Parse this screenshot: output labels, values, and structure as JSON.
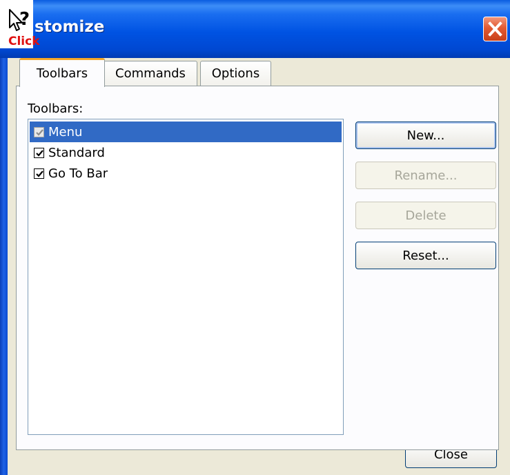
{
  "window": {
    "title": "stomize",
    "help_cursor_label": "Click"
  },
  "tabs": [
    {
      "label": "Toolbars",
      "active": true
    },
    {
      "label": "Commands",
      "active": false
    },
    {
      "label": "Options",
      "active": false
    }
  ],
  "toolbars_label": "Toolbars:",
  "toolbars_list": [
    {
      "label": "Menu",
      "checked": true,
      "selected": true,
      "enabled": false
    },
    {
      "label": "Standard",
      "checked": true,
      "selected": false,
      "enabled": true
    },
    {
      "label": "Go To Bar",
      "checked": true,
      "selected": false,
      "enabled": true
    }
  ],
  "buttons": {
    "new": "New...",
    "rename": "Rename...",
    "delete": "Delete",
    "reset": "Reset...",
    "close": "Close"
  },
  "colors": {
    "titlebar": "#0053e3",
    "selection": "#316ac5",
    "dialog_bg": "#ece9d8",
    "close_button": "#e35a32",
    "active_tab_accent": "#f5a726"
  },
  "icons": [
    "whats-this-cursor-icon",
    "close-icon",
    "checkbox-checked-icon"
  ]
}
